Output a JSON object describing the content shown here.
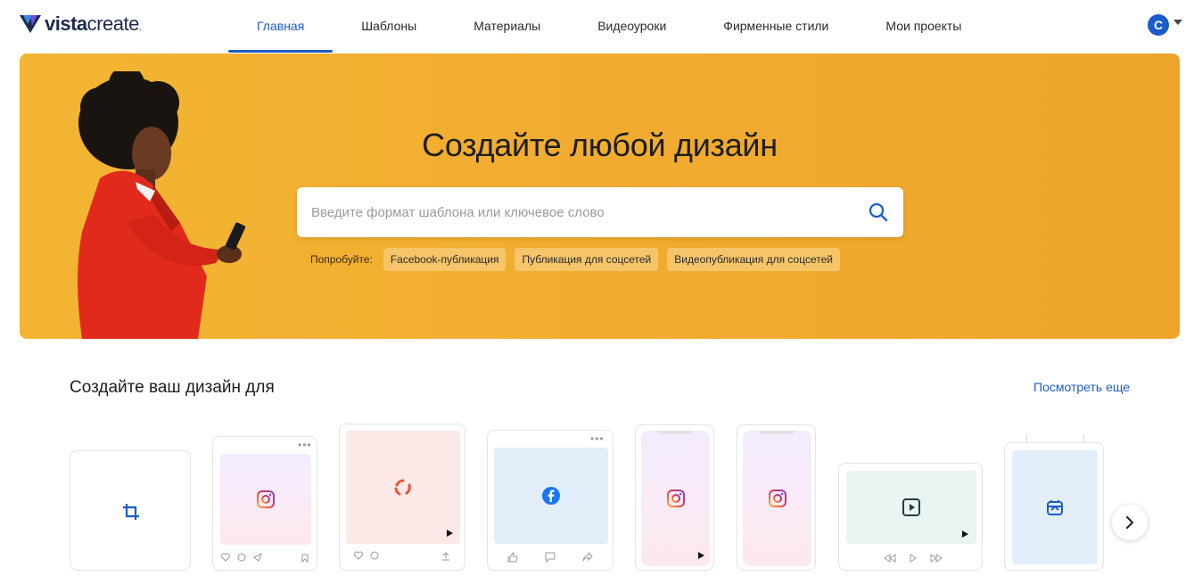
{
  "header": {
    "logo_bold": "vista",
    "logo_light": "create",
    "logo_mark": ".",
    "nav": [
      {
        "label": "Главная",
        "active": true
      },
      {
        "label": "Шаблоны",
        "active": false
      },
      {
        "label": "Материалы",
        "active": false
      },
      {
        "label": "Видеоуроки",
        "active": false
      },
      {
        "label": "Фирменные стили",
        "active": false
      },
      {
        "label": "Мои проекты",
        "active": false
      }
    ],
    "avatar_letter": "C"
  },
  "hero": {
    "title": "Создайте любой дизайн",
    "search_placeholder": "Введите формат шаблона или ключевое слово",
    "try_label": "Попробуйте:",
    "chips": [
      "Facebook-публикация",
      "Публикация для соцсетей",
      "Видеопубликация для соцсетей"
    ],
    "background_color": "#f1ac30"
  },
  "section": {
    "title": "Создайте ваш дизайн для",
    "see_more": "Посмотреть еще"
  },
  "cards": [
    {
      "icon": "crop-icon"
    },
    {
      "icon": "instagram-icon"
    },
    {
      "icon": "reels-icon"
    },
    {
      "icon": "facebook-icon"
    },
    {
      "icon": "instagram-icon"
    },
    {
      "icon": "instagram-icon"
    },
    {
      "icon": "video-play-icon"
    },
    {
      "icon": "poster-icon"
    }
  ],
  "colors": {
    "accent": "#1a5cc8"
  }
}
